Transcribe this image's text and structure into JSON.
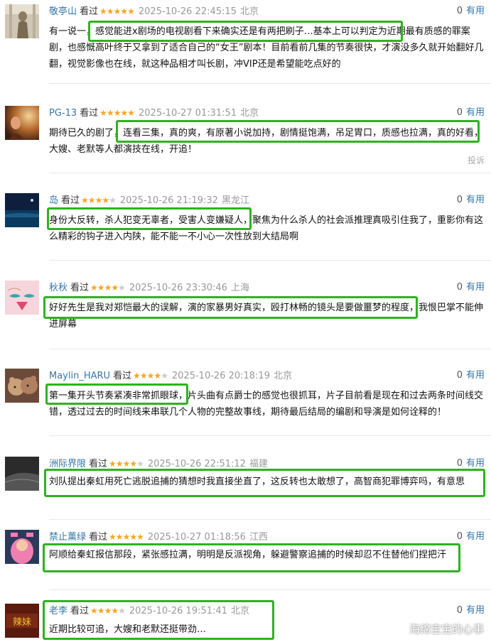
{
  "reviews": [
    {
      "user": "敬亭山",
      "seen": "看过",
      "rating": 5,
      "time": "2025-10-26 22:45:15",
      "loc": "北京",
      "useful_count": "0",
      "useful_label": "有用",
      "text": "有一说一，感觉能进x剧场的电视剧看下来确实还是有两把刷子…基本上可以判定为近期最有质感的罪案剧，也感慨高叶终于又拿到了适合自己的“女王”剧本！目前看前几集的节奏很快，才演没多久就开始翻好几翻，视觉影像也在线，就这种品相才叫长剧，冲VIP还是希望能吃点好的"
    },
    {
      "user": "PG-13",
      "seen": "看过",
      "rating": 5,
      "time": "2025-10-27 01:31:51",
      "loc": "北京",
      "useful_count": "0",
      "useful_label": "有用",
      "text": "期待已久的剧了，连看三集，真的爽，有原著小说加持，剧情挺饱满，吊足胃口，质感也拉满，真的好看，大嫂、老默等人都演技在线，开追！",
      "report": "投诉"
    },
    {
      "user": "岛",
      "seen": "看过",
      "rating": 4,
      "time": "2025-10-26 21:19:32",
      "loc": "黑龙江",
      "useful_count": "0",
      "useful_label": "有用",
      "text": "身份大反转，杀人犯变无辜者，受害人变嫌疑人，聚焦为什么杀人的社会派推理真吸引住我了，重影你有这么精彩的钩子进入内陕，能不能一不小心一次性放到大结局啊"
    },
    {
      "user": "秋秋",
      "seen": "看过",
      "rating": 4,
      "time": "2025-10-26 23:30:46",
      "loc": "上海",
      "useful_count": "0",
      "useful_label": "有用",
      "text": "好好先生是我对郑恺最大的误解，演的家暴男好真实，殴打林畅的镜头是要做噩梦的程度，我恨巴掌不能伸进屏幕"
    },
    {
      "user": "Maylin_HARU",
      "seen": "看过",
      "rating": 4,
      "time": "2025-10-26 20:18:19",
      "loc": "北京",
      "useful_count": "0",
      "useful_label": "有用",
      "text": "第一集开头节奏紧凑非常抓眼球，片头曲有点爵士的感觉也很抓耳，片子目前看是现在和过去两条时间线交错，透过过去的时间线来串联几个人物的完整故事线，期待最后结局的编剧和导演是如何诠释的！"
    },
    {
      "user": "洲际界限",
      "seen": "看过",
      "rating": 4,
      "time": "2025-10-26 22:51:12",
      "loc": "福建",
      "useful_count": "0",
      "useful_label": "有用",
      "text": "刘队提出秦虹用死亡逃脱追捕的猜想时我直接坐直了，这反转也太敢想了，高智商犯罪博弈吗，有意思"
    },
    {
      "user": "禁止薰绿",
      "seen": "看过",
      "rating": 5,
      "time": "2025-10-27 01:18:56",
      "loc": "江西",
      "useful_count": "0",
      "useful_label": "有用",
      "text": "阿顺给秦虹报信那段，紧张感拉满，明明是反派视角，躲避警察追捕的时候却忍不住替他们捏把汗"
    },
    {
      "user": "老李",
      "seen": "看过",
      "rating": 4,
      "time": "2025-10-26 19:51:41",
      "loc": "北京",
      "useful_count": "0",
      "useful_label": "有用",
      "text": "近期比较可追，大嫂和老默还挺带劲…"
    }
  ],
  "avatar_labels": {
    "r7": "辣妹"
  },
  "watermark": "海绵宝宝的心事",
  "colors": {
    "username": "#3377aa",
    "star_on": "#f5a623",
    "star_off": "#cccccc",
    "highlight": "#2db31f",
    "meta_gray": "#999999"
  }
}
